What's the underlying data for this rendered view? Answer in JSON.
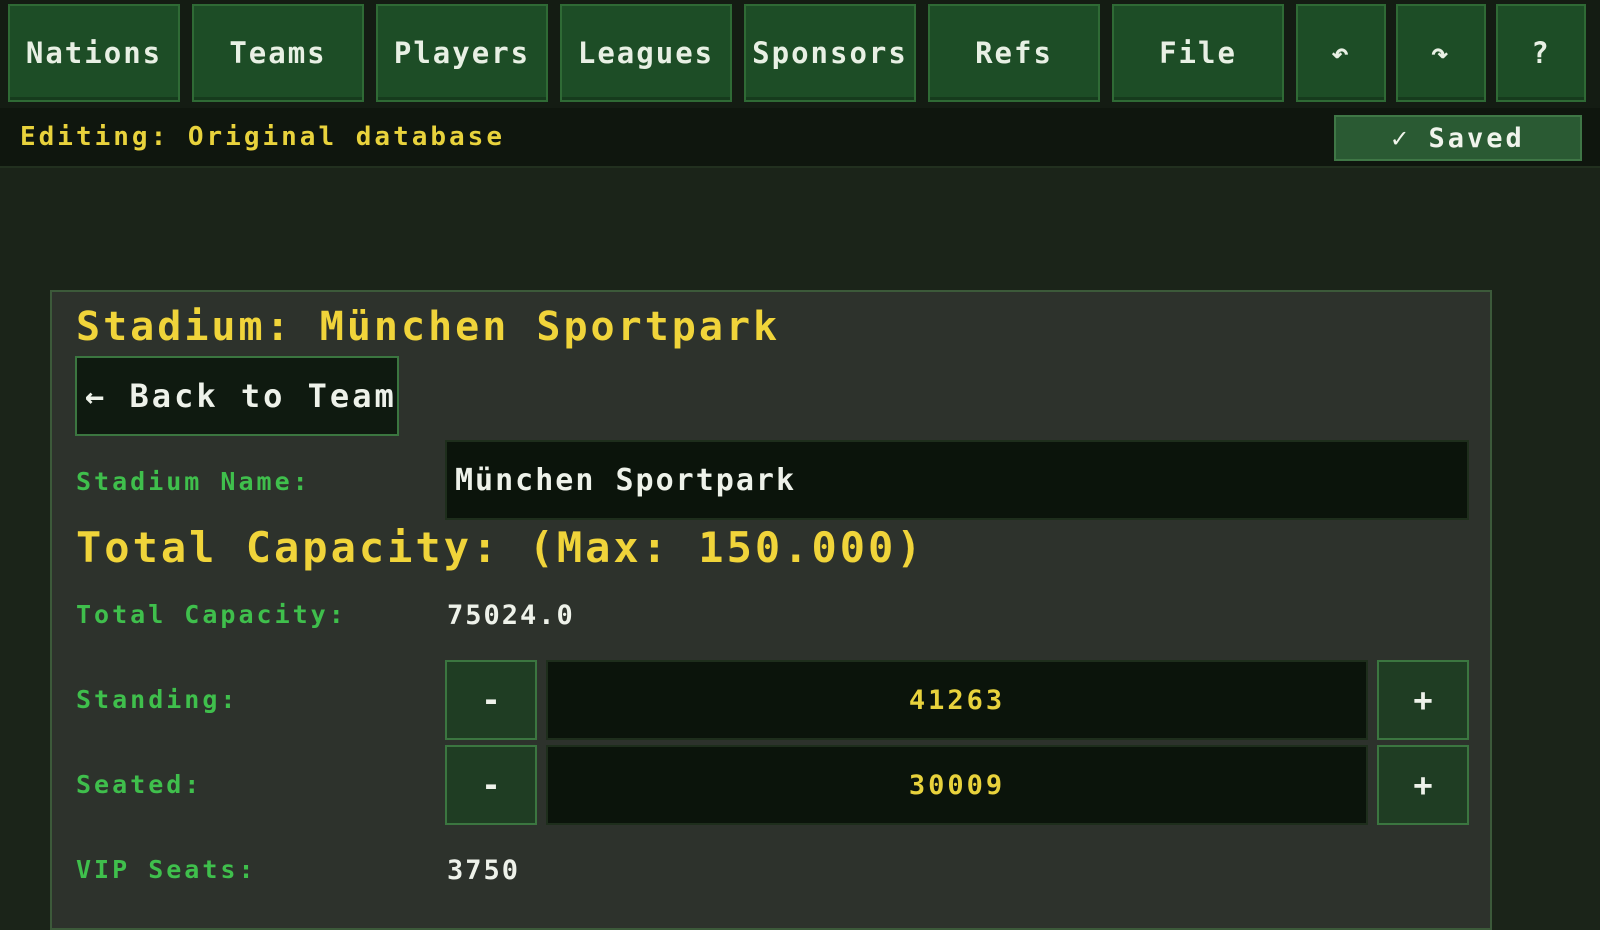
{
  "nav": {
    "items": [
      {
        "label": "Nations"
      },
      {
        "label": "Teams"
      },
      {
        "label": "Players"
      },
      {
        "label": "Leagues"
      },
      {
        "label": "Sponsors"
      },
      {
        "label": "Refs"
      },
      {
        "label": "File"
      },
      {
        "label": "↶",
        "icon": "undo-icon"
      },
      {
        "label": "↷",
        "icon": "redo-icon"
      },
      {
        "label": "?",
        "icon": "help-icon"
      }
    ]
  },
  "status": {
    "editing_text": "Editing: Original database",
    "saved_check": "✓",
    "saved_label": "Saved"
  },
  "stadium": {
    "title": "Stadium: München Sportpark",
    "back_label": "← Back to Team",
    "name_label": "Stadium Name:",
    "name_value": "München Sportpark",
    "capacity_heading": "Total Capacity:  (Max: 150.000)",
    "total_capacity_label": "Total Capacity:",
    "total_capacity_value": "75024.0",
    "standing_label": "Standing:",
    "standing_value": "41263",
    "seated_label": "Seated:",
    "seated_value": "30009",
    "vip_label": "VIP Seats:",
    "vip_value": "3750",
    "minus_label": "-",
    "plus_label": "+"
  },
  "colors": {
    "accent_yellow": "#f0d43a",
    "label_green": "#3fbf4c",
    "button_green": "#1d4d26",
    "background": "#1b2419"
  }
}
